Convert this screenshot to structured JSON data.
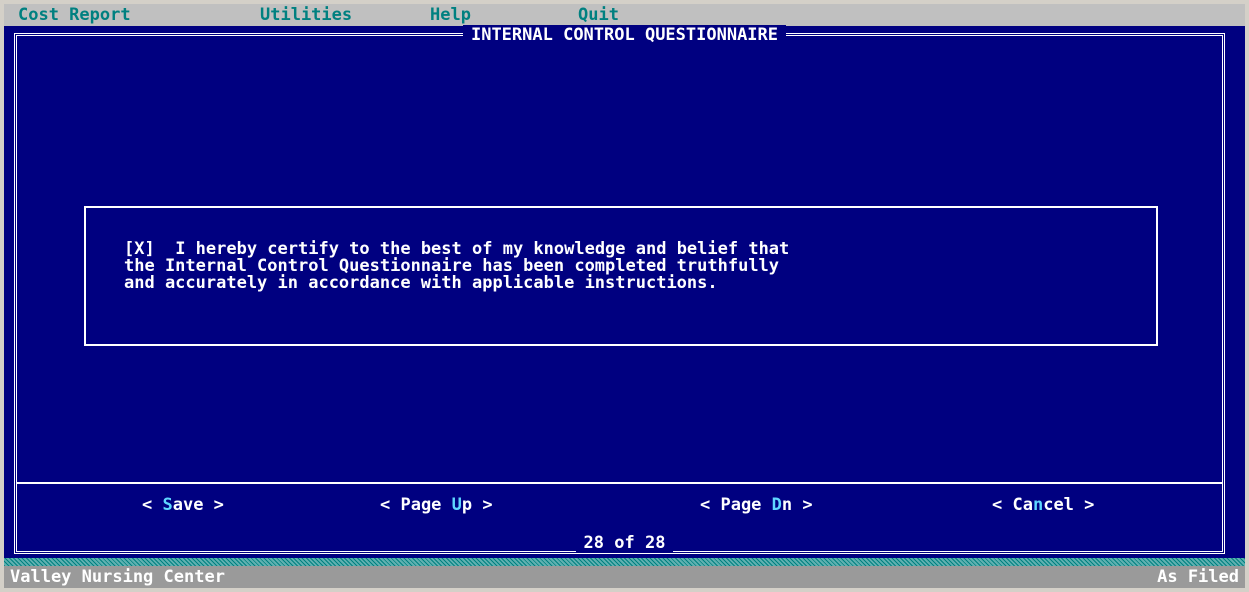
{
  "menu": {
    "items": [
      "Cost Report",
      "Utilities",
      "Help",
      "Quit"
    ]
  },
  "dialog": {
    "title": "INTERNAL CONTROL QUESTIONNAIRE",
    "certification": {
      "checkbox": "[X]",
      "lines": [
        "  I hereby certify to the best of my knowledge and belief that",
        "the Internal Control Questionnaire has been completed truthfully",
        "and accurately in accordance with applicable instructions."
      ]
    },
    "buttons": {
      "save": {
        "pre": "< ",
        "hot": "S",
        "post": "ave >"
      },
      "page_up": {
        "pre": "< Page ",
        "hot": "U",
        "post": "p >"
      },
      "page_dn": {
        "pre": "< Page ",
        "hot": "D",
        "post": "n >"
      },
      "cancel": {
        "pre": "< Ca",
        "hot": "n",
        "post": "cel >"
      }
    },
    "page_counter": "28 of 28"
  },
  "status": {
    "facility": "Valley Nursing Center",
    "mode": "As Filed"
  },
  "colors": {
    "background": "#000080",
    "text": "#ffffff",
    "menu_bg": "#c0c0c0",
    "menu_text": "#008080",
    "hotkey": "#5fd7ff",
    "status_bg": "#9a9a9a"
  }
}
